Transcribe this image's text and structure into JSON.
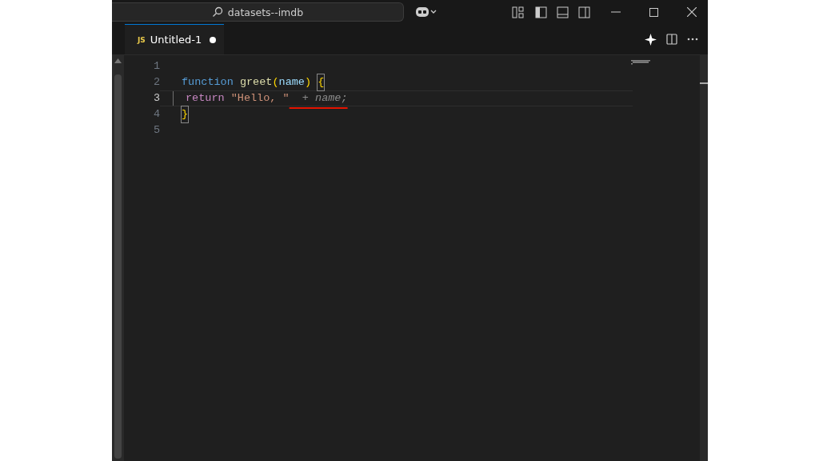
{
  "title_bar": {
    "search": "datasets--imdb"
  },
  "tabs": [
    {
      "badge": "JS",
      "label": "Untitled-1",
      "selected": true,
      "modified": true
    }
  ],
  "editor": {
    "lines": [
      {
        "number": "1",
        "current": false
      },
      {
        "number": "2",
        "current": false,
        "tokens": [
          {
            "text": "function ",
            "kind": "keyword"
          },
          {
            "text": "greet",
            "kind": "function"
          },
          {
            "text": "(",
            "kind": "bracket"
          },
          {
            "text": "name",
            "kind": "param"
          },
          {
            "text": ") ",
            "kind": "bracket"
          },
          {
            "text": "{",
            "kind": "bracket-match"
          }
        ]
      },
      {
        "number": "3",
        "current": true,
        "indent_guide": true,
        "tokens": [
          {
            "text": "return ",
            "kind": "control"
          },
          {
            "text": "\"Hello, \"",
            "kind": "string"
          },
          {
            "text": "  + name;",
            "kind": "ghost",
            "underlined": true
          }
        ]
      },
      {
        "number": "4",
        "current": false,
        "tokens": [
          {
            "text": "}",
            "kind": "bracket-match"
          }
        ]
      },
      {
        "number": "5",
        "current": false
      }
    ]
  }
}
